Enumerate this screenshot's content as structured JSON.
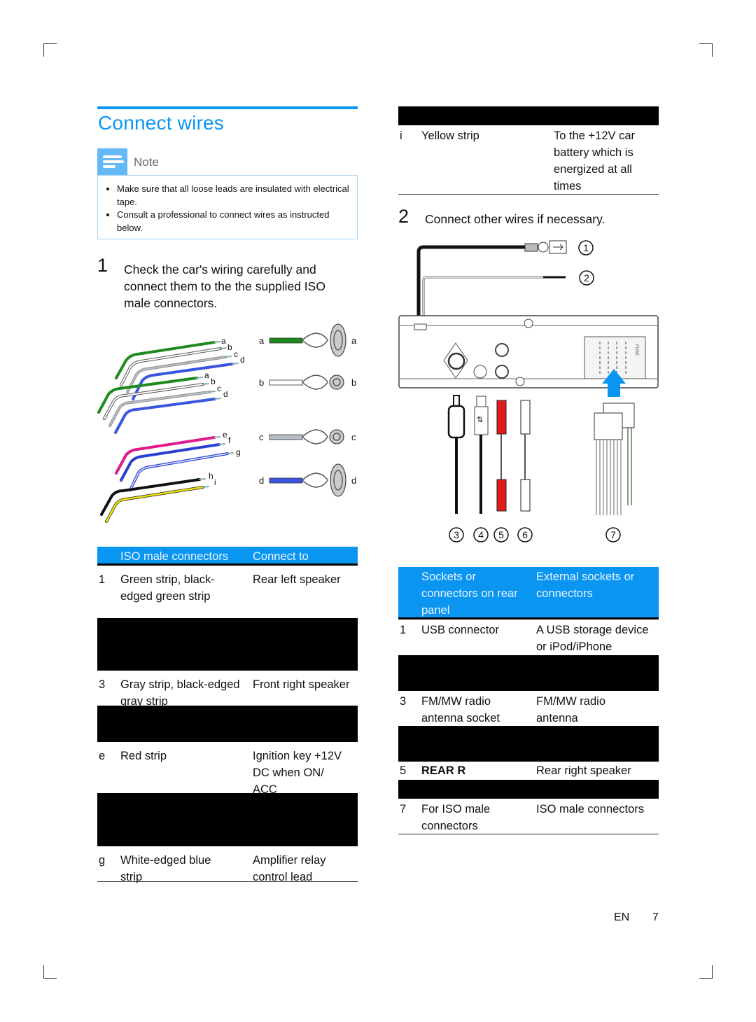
{
  "section": {
    "title": "Connect wires"
  },
  "note": {
    "label": "Note",
    "items": [
      "Make sure that all loose leads are insulated with electrical tape.",
      "Consult a professional to connect wires as instructed below."
    ]
  },
  "step1": {
    "number": "1",
    "text": "Check the car's wiring carefully and connect them to the the supplied ISO male connectors."
  },
  "step2": {
    "number": "2",
    "text": "Connect other wires if necessary."
  },
  "wire_diagram": {
    "wire_labels": [
      "a",
      "b",
      "c",
      "d",
      "a",
      "b",
      "c",
      "d",
      "e",
      "f",
      "g",
      "h",
      "i"
    ],
    "speaker_labels": [
      "a",
      "b",
      "c",
      "d"
    ],
    "colors": {
      "green": "#1e8a1e",
      "white": "#ffffff",
      "gray": "#b4bec4",
      "blue": "#3a55e0",
      "pink": "#e01a8c",
      "black": "#111111",
      "yellow": "#f0e010",
      "accent": "#0a96f0"
    }
  },
  "rear_diagram": {
    "callouts_top": [
      "1",
      "2"
    ],
    "callouts_bottom": [
      "3",
      "4",
      "5",
      "6",
      "7"
    ],
    "fuse_label": "FUSE"
  },
  "iso_table": {
    "headers": [
      "ISO male connectors",
      "Connect to"
    ],
    "rows": [
      {
        "id": "1",
        "connector": "Green strip, black-edged green strip",
        "connect_to": "Rear left speaker"
      },
      {
        "redacted": true
      },
      {
        "id": "3",
        "connector": "Gray strip, black-edged gray strip",
        "connect_to": "Front right speaker"
      },
      {
        "redacted": true
      },
      {
        "id": "e",
        "connector": "Red strip",
        "connect_to": "Ignition key +12V DC when ON/ ACC"
      },
      {
        "redacted": true
      },
      {
        "id": "g",
        "connector": "White-edged blue strip",
        "connect_to": "Amplifier relay control lead"
      }
    ]
  },
  "iso_table_cont": {
    "rows": [
      {
        "id": "i",
        "connector": "Yellow strip",
        "connect_to": "To the +12V car battery which is energized at all times"
      }
    ]
  },
  "sockets_table": {
    "headers": [
      "Sockets or connectors on rear panel",
      "External sockets or connectors"
    ],
    "rows": [
      {
        "id": "1",
        "socket": "USB connector",
        "external": "A USB storage device or iPod/iPhone"
      },
      {
        "redacted": true
      },
      {
        "id": "3",
        "socket": "FM/MW radio antenna socket",
        "external": "FM/MW radio antenna"
      },
      {
        "redacted": true
      },
      {
        "id": "5",
        "socket": "REAR R",
        "external": "Rear right speaker"
      },
      {
        "redacted": true
      },
      {
        "id": "7",
        "socket": "For ISO male connectors",
        "external": "ISO male connectors"
      }
    ]
  },
  "footer": {
    "language": "EN",
    "page": "7"
  }
}
